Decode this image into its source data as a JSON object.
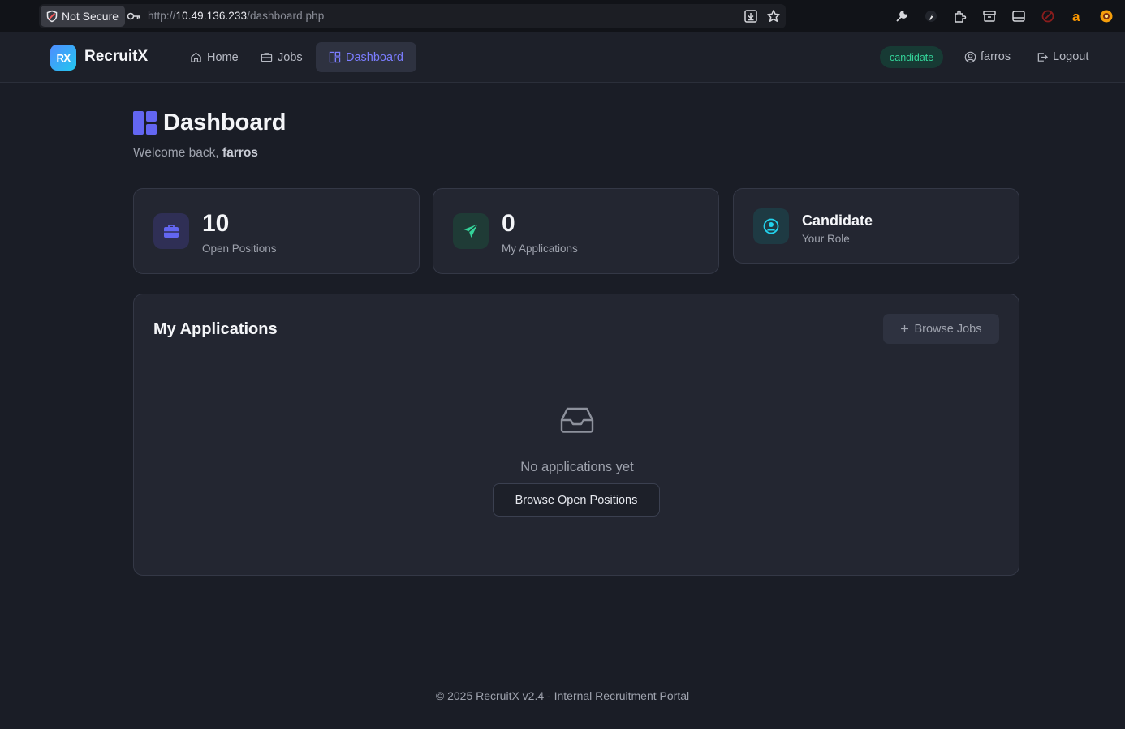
{
  "browser": {
    "security_label": "Not Secure",
    "url_scheme": "http://",
    "url_host": "10.49.136.233",
    "url_path": "/dashboard.php"
  },
  "navbar": {
    "logo_badge": "RX",
    "brand": "RecruitX",
    "links": [
      {
        "label": "Home",
        "icon": "home-icon",
        "active": false
      },
      {
        "label": "Jobs",
        "icon": "briefcase-icon",
        "active": false
      },
      {
        "label": "Dashboard",
        "icon": "dashboard-icon",
        "active": true
      }
    ],
    "role_badge": "candidate",
    "username": "farros",
    "logout_label": "Logout"
  },
  "header": {
    "title": "Dashboard",
    "welcome_prefix": "Welcome back, ",
    "welcome_name": "farros"
  },
  "stats": [
    {
      "value": "10",
      "label": "Open Positions",
      "icon": "briefcase-icon",
      "color": "#6366f1"
    },
    {
      "value": "0",
      "label": "My Applications",
      "icon": "paper-plane-icon",
      "color": "#34d399"
    },
    {
      "value": "Candidate",
      "label": "Your Role",
      "icon": "user-circle-icon",
      "color": "#22d3ee"
    }
  ],
  "applications": {
    "title": "My Applications",
    "browse_jobs_label": "Browse Jobs",
    "empty_text": "No applications yet",
    "browse_open_label": "Browse Open Positions"
  },
  "footer": {
    "text": "© 2025 RecruitX v2.4 - Internal Recruitment Portal"
  },
  "colors": {
    "accent": "#6366f1",
    "success": "#34d399",
    "background": "#1a1d26",
    "card": "#232631"
  }
}
